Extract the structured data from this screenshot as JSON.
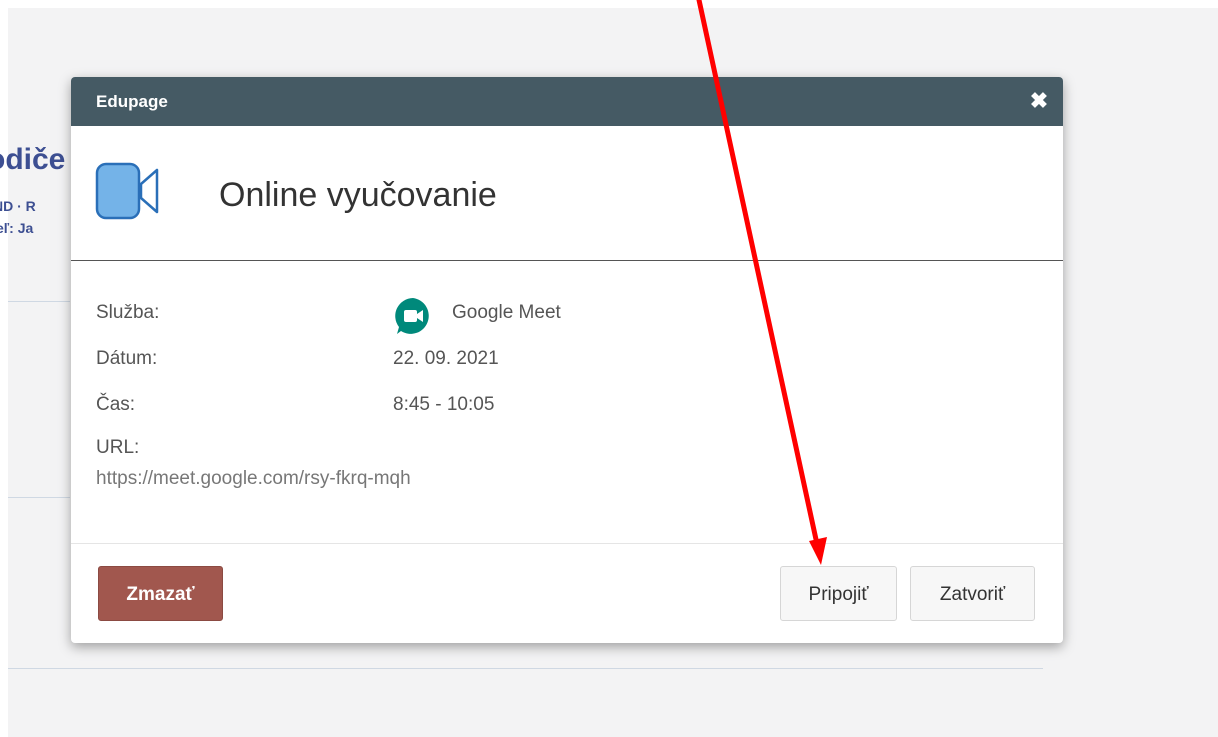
{
  "background": {
    "heading": "odiče",
    "line1": "ND · R",
    "line2": "eľ:  Ja"
  },
  "dialog": {
    "title": "Edupage",
    "close_label": "✖",
    "hero_title": "Online vyučovanie",
    "details": {
      "service_label": "Služba:",
      "service_value": "Google Meet",
      "date_label": "Dátum:",
      "date_value": "22. 09. 2021",
      "time_label": "Čas:",
      "time_value": "8:45 - 10:05",
      "url_label": "URL:",
      "url_value": "https://meet.google.com/rsy-fkrq-mqh"
    },
    "buttons": {
      "delete": "Zmazať",
      "connect": "Pripojiť",
      "close": "Zatvoriť"
    }
  },
  "colors": {
    "header_bg": "#455a64",
    "delete_bg": "#a1574e",
    "video_icon": "#74b3e8",
    "meet_icon": "#00897b",
    "annotation_arrow": "#ff0000"
  },
  "icons": {
    "close": "close-icon",
    "video": "video-camera-icon",
    "meet": "google-meet-icon"
  }
}
